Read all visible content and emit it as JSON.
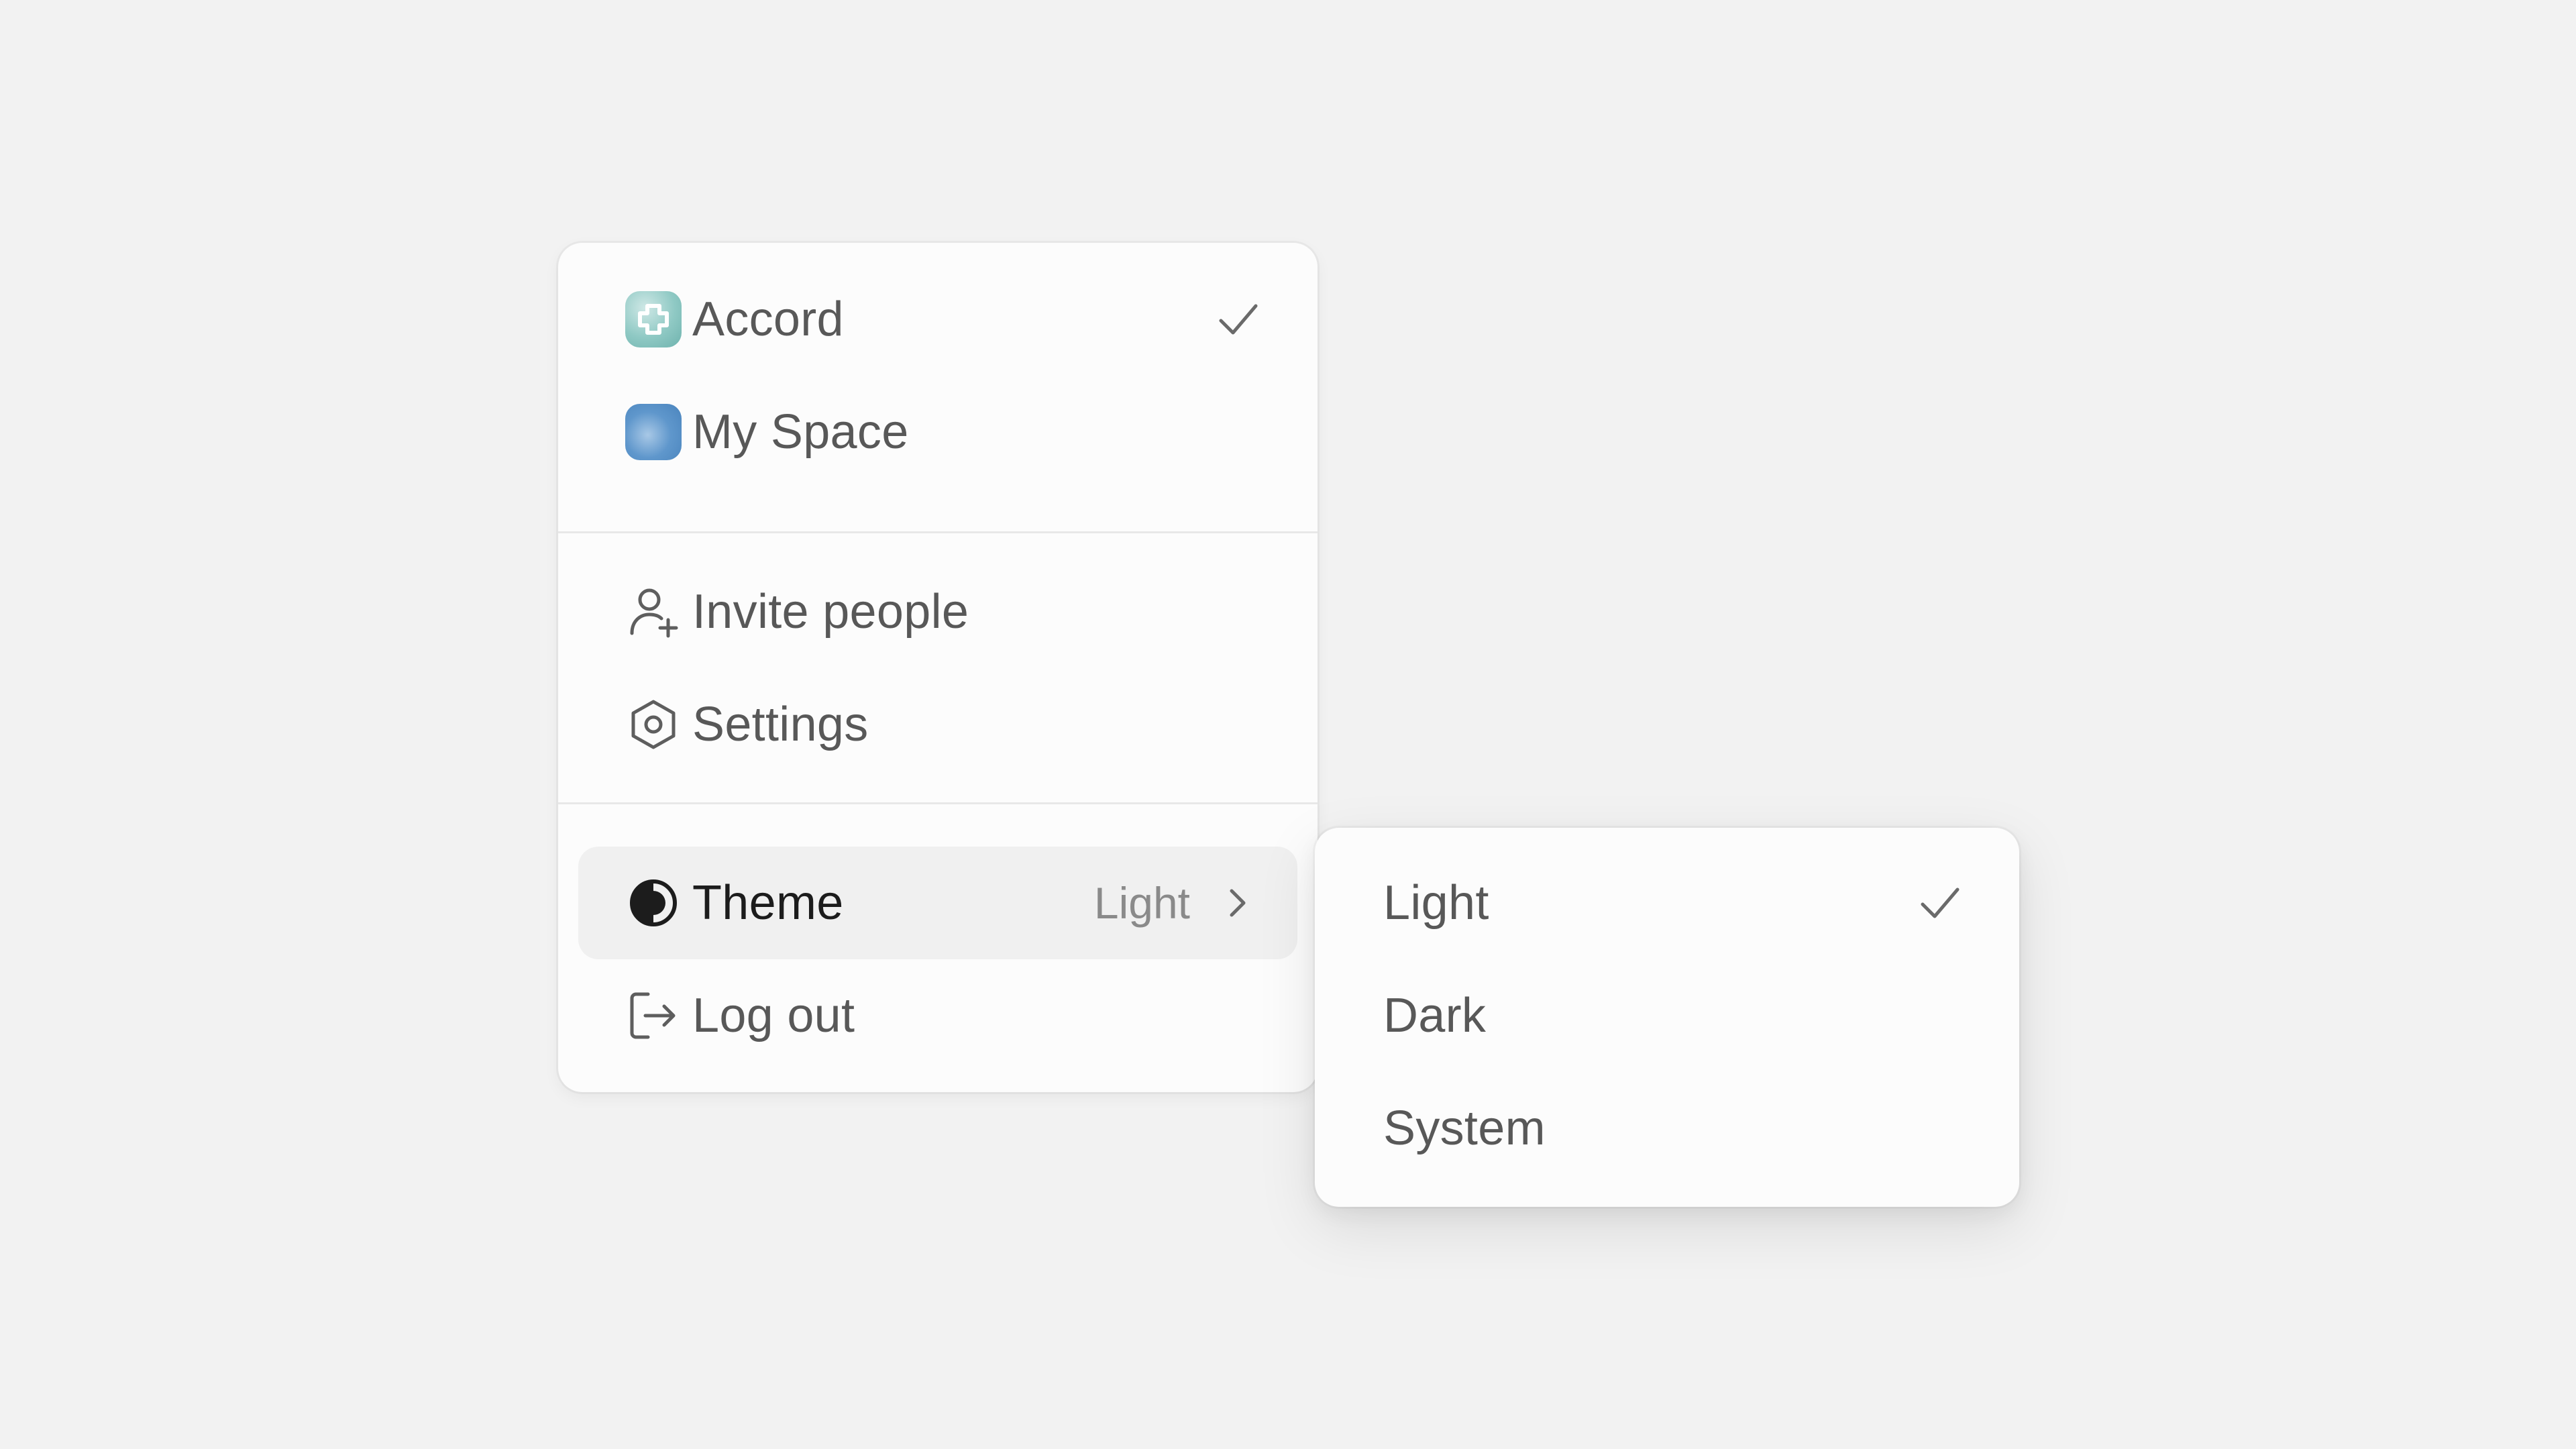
{
  "menu": {
    "workspaces": [
      {
        "name": "Accord",
        "selected": true,
        "icon": "accord-logo-icon"
      },
      {
        "name": "My Space",
        "selected": false,
        "icon": "my-space-avatar-icon"
      }
    ],
    "actions": [
      {
        "label": "Invite people",
        "icon": "user-plus-icon"
      },
      {
        "label": "Settings",
        "icon": "gear-icon"
      }
    ],
    "theme": {
      "label": "Theme",
      "value": "Light",
      "icon": "contrast-icon"
    },
    "logout": {
      "label": "Log out",
      "icon": "logout-icon"
    }
  },
  "theme_submenu": {
    "options": [
      {
        "label": "Light",
        "selected": true
      },
      {
        "label": "Dark",
        "selected": false
      },
      {
        "label": "System",
        "selected": false
      }
    ]
  },
  "colors": {
    "background": "#f2f2f2",
    "panel": "#fcfcfc",
    "text": "#585858",
    "active_text": "#1c1c1c",
    "muted": "#8a8a8a"
  }
}
